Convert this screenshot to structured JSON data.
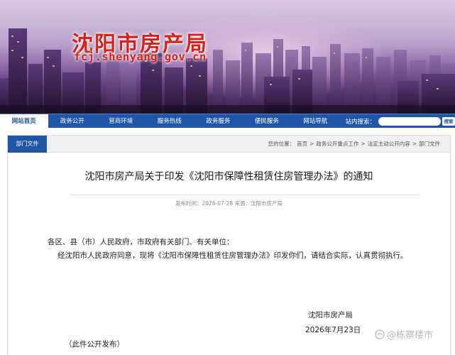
{
  "banner": {
    "site_title": "沈阳市房产局",
    "site_url": "fcj.shenyang.gov.cn"
  },
  "nav": {
    "items": [
      "网站首页",
      "政务公开",
      "营商环境",
      "服务热线",
      "政务服务",
      "便民服务",
      "网站导航"
    ],
    "active_index": 0,
    "search_label": "站内搜索：",
    "search_placeholder": "",
    "search_button": "搜索"
  },
  "breadcrumb_bar": {
    "section_tab": "部门文件",
    "crumbs": [
      "您的位置：",
      "首页",
      ">",
      "政务公开重点工作",
      ">",
      "法定主动公开内容",
      ">",
      "部门文件"
    ]
  },
  "article": {
    "title": "沈阳市房产局关于印发《沈阳市保障性租赁住房管理办法》的通知",
    "meta": "发布时间：2026-07-28   来源：沈阳市房产局",
    "salutation": "各区、县（市）人民政府，市政府有关部门、有关单位：",
    "paragraph": "经沈阳市人民政府同意，现将《沈阳市保障性租赁住房管理办法》印发你们，请结合实际，认真贯彻执行。",
    "signature_org": "沈阳市房产局",
    "signature_date": "2026年7月23日",
    "footnote": "（此件公开发布）"
  },
  "watermark": "@栋察楼市",
  "colors": {
    "nav_blue": "#1f56a8",
    "title_red": "#d9201a"
  }
}
